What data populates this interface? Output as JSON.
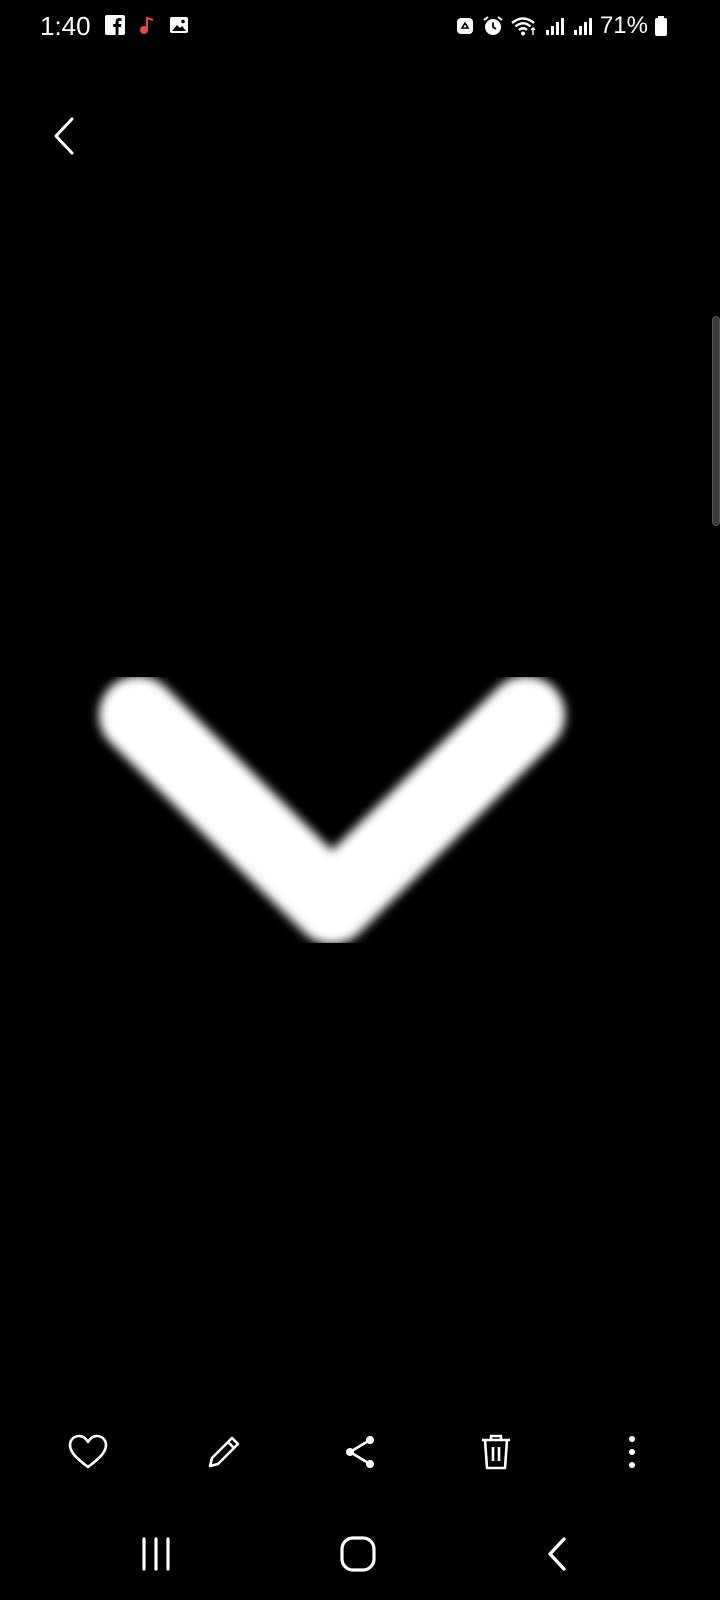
{
  "status_bar": {
    "time": "1:40",
    "battery_percent": "71%",
    "left_icons": [
      "facebook-icon",
      "music-note-icon",
      "gallery-icon"
    ],
    "right_icons": [
      "recycle-icon",
      "alarm-icon",
      "wifi-icon",
      "signal-icon",
      "signal-icon",
      "battery-icon"
    ]
  },
  "colors": {
    "background": "#000000",
    "foreground": "#ffffff",
    "music_icon_accent": "#e04b4b"
  },
  "actions": {
    "favorite": "heart-icon",
    "edit": "pencil-icon",
    "share": "share-icon",
    "delete": "trash-icon",
    "more": "more-vertical-icon"
  },
  "nav": {
    "recents": "recent-apps-icon",
    "home": "home-icon",
    "back": "back-icon"
  }
}
